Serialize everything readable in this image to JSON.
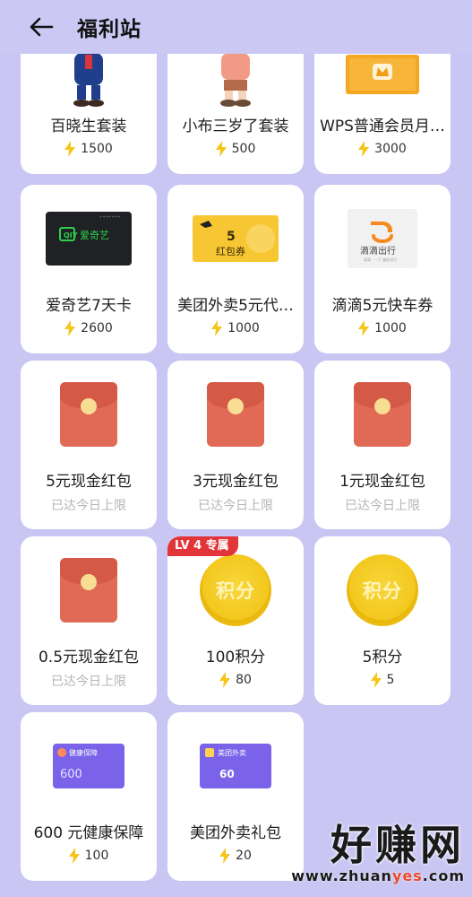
{
  "header": {
    "title": "福利站"
  },
  "items": [
    {
      "name": "百晓生套装",
      "points": "1500",
      "image": "mascot-figure-blue"
    },
    {
      "name": "小布三岁了套装",
      "points": "500",
      "image": "mascot-figure-pink"
    },
    {
      "name": "WPS普通会员月…",
      "points": "3000",
      "image": "wps-membership-card"
    },
    {
      "name": "爱奇艺7天卡",
      "points": "2600",
      "image": "iqiyi-card",
      "card_text": "爱奇艺"
    },
    {
      "name": "美团外卖5元代…",
      "points": "1000",
      "image": "meituan-red-packet",
      "card_text": "5 红包券"
    },
    {
      "name": "滴滴5元快车券",
      "points": "1000",
      "image": "didi-logo",
      "card_text": "滴滴出行"
    },
    {
      "name": "5元现金红包",
      "status": "已达今日上限",
      "image": "red-envelope-icon"
    },
    {
      "name": "3元现金红包",
      "status": "已达今日上限",
      "image": "red-envelope-icon"
    },
    {
      "name": "1元现金红包",
      "status": "已达今日上限",
      "image": "red-envelope-icon"
    },
    {
      "name": "0.5元现金红包",
      "status": "已达今日上限",
      "image": "red-envelope-icon"
    },
    {
      "name": "100积分",
      "points": "80",
      "image": "points-coin-icon",
      "coin_text": "积分",
      "badge": "LV 4 专属"
    },
    {
      "name": "5积分",
      "points": "5",
      "image": "points-coin-icon",
      "coin_text": "积分"
    },
    {
      "name": "600 元健康保障",
      "points": "100",
      "image": "health-card",
      "card_title": "健康保障",
      "card_amount": "600"
    },
    {
      "name": "美团外卖礼包",
      "points": "20",
      "image": "meituan-gift-card",
      "card_title": "美团外卖",
      "card_amount": "60"
    }
  ],
  "watermark": {
    "main": "好赚网",
    "url_prefix": "www.zhuan",
    "url_highlight": "yes",
    "url_suffix": ".com"
  },
  "colors": {
    "background": "#c9c6f3",
    "bolt": "#f5c518",
    "badge": "#e2353a",
    "coin": "#f3c81e",
    "envelope": "#e06a55"
  }
}
